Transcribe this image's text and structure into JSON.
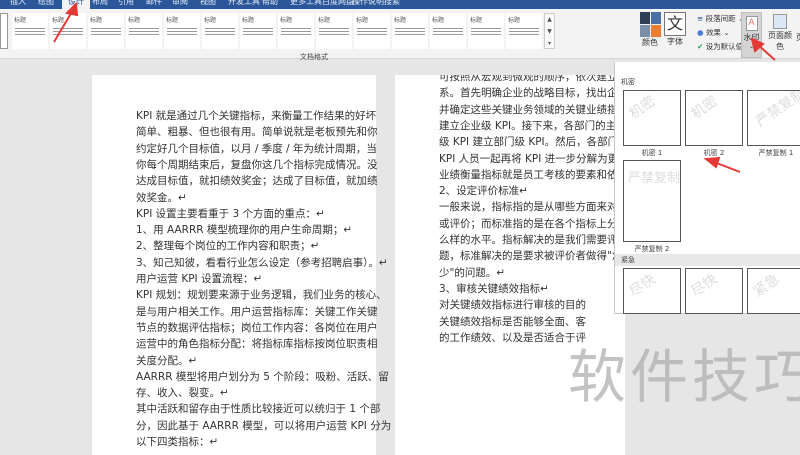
{
  "tabs": [
    "插入",
    "绘图",
    "设计",
    "布局",
    "引用",
    "邮件",
    "审阅",
    "视图",
    "开发工具",
    "帮助",
    "更多工具",
    "百度网盘",
    "操作说明搜索"
  ],
  "active_tab": "设计",
  "ribbon": {
    "style_gallery": [
      "标题",
      "标题",
      "标题",
      "标题",
      "标题",
      "标题",
      "标题",
      "标题",
      "标题",
      "标题",
      "标题",
      "标题",
      "标题",
      "标题"
    ],
    "group_label": "文档格式",
    "colors_label": "颜色",
    "fonts_label": "字体",
    "fonts_glyph": "文",
    "paragraph_spacing": "段落间距",
    "effects": "效果",
    "set_default": "设为默认值",
    "watermark": "水印",
    "page_color": "页面颜色",
    "page_border": "页"
  },
  "watermark_panel": {
    "section1": "机密",
    "items1": [
      {
        "label": "机密 1",
        "text": "机密"
      },
      {
        "label": "机密 2",
        "text": "机密"
      },
      {
        "label": "严禁复制 1",
        "text": "严禁复制"
      },
      {
        "label": "严禁复制 2",
        "text": "严禁复制"
      }
    ],
    "section2": "紧急",
    "items2": [
      {
        "text": "尽快"
      },
      {
        "text": "尽快"
      },
      {
        "text": "紧急"
      }
    ]
  },
  "page_left": [
    "KPI 就是通过几个关键指标，来衡量工作结果的好坏",
    "简单、粗暴、但也很有用。简单说就是老板预先和你",
    "约定好几个目标值，以月 / 季度 / 年为统计周期，当",
    "你每个周期结束后，复盘你这几个指标完成情况。没",
    "达成目标值，就扣绩效奖金；达成了目标值，就加绩",
    "效奖金。↵",
    "KPI 设置主要看重于 3 个方面的重点：↵",
    "1、用 AARRR 模型梳理你的用户生命周期；↵",
    "2、整理每个岗位的工作内容和职责；↵",
    "3、知己知彼，看看行业怎么设定（参考招聘启事）。↵",
    "用户运营 KPI 设置流程：↵",
    "KPI 规划：规划要来源于业务逻辑，我们业务的核心、",
    "是与用户相关工作。用户运营指标库：关键工作关键",
    "节点的数据评估指标；岗位工作内容：各岗位在用户",
    "运营中的角色指标分配：将指标库指标按岗位职责相",
    "关度分配。↵",
    "AARRR 模型将用户划分为 5 个阶段：吸粉、活跃、留",
    "存、收入、裂变。↵",
    "其中活跃和留存由于性质比较接近可以统归于 1 个部",
    "分，因此基于 AARRR 模型，可以将用户运营 KPI 分为",
    "以下四类指标：↵"
  ],
  "page_right": [
    "可按照从宏观到微观的顺序，依次建立各级的",
    "系。首先明确企业的战略目标，找出企业的业务",
    "并确定这些关键业务领域的关键业绩指标（KF",
    "建立企业级 KPI。接下来，各部门的主管需要依",
    "级 KPI 建立部门级 KPI。然后，各部门的主管和",
    "KPI 人员一起再将 KPI 进一步分解为更细的 KF",
    "业绩衡量指标就是员工考核的要素和依据。↵",
    "2、设定评价标准↵",
    "一般来说，指标指的是从哪些方面来对工作进",
    "或评价；而标准指的是在各个指标上分别应该",
    "么样的水平。指标解决的是我们需要评价\"什",
    "题，标准解决的是要求被评价者做得\"怎样\"、",
    "少\"的问题。↵",
    "3、审核关键绩效指标↵",
    "对关键绩效指标进行审核的目的",
    "关键绩效指标是否能够全面、客",
    "的工作绩效、以及是否适合于评"
  ],
  "overlay_watermark": "软件技巧",
  "colors": {
    "tabbar": "#2b579a",
    "arrow": "#e53935",
    "swatch": [
      "#2f3e55",
      "#4a6fa5",
      "#7c8ea6",
      "#ed7d31"
    ]
  }
}
